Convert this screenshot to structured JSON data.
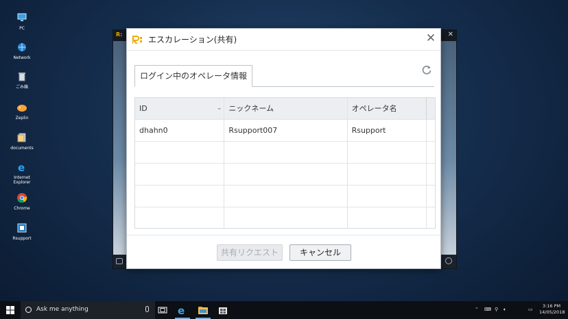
{
  "desktop": {
    "icons": [
      {
        "label": "PC",
        "icon": "monitor-icon"
      },
      {
        "label": "Network",
        "icon": "network-icon"
      },
      {
        "label": "ごみ箱",
        "icon": "recycle-bin-icon"
      },
      {
        "label": "Zeplin",
        "icon": "zeplin-icon"
      },
      {
        "label": "documents",
        "icon": "document-icon"
      },
      {
        "label": "Internet Explorer",
        "icon": "ie-icon"
      },
      {
        "label": "Chrome",
        "icon": "chrome-icon"
      },
      {
        "label": "Rsupport",
        "icon": "rsupport-icon"
      }
    ]
  },
  "dialog": {
    "title": "エスカレーション(共有)",
    "tab_label": "ログイン中のオペレータ情報",
    "columns": [
      "ID",
      "ニックネーム",
      "オペレータ名"
    ],
    "rows": [
      [
        "dhahn0",
        "Rsupport007",
        "Rsupport"
      ],
      [
        "",
        "",
        ""
      ],
      [
        "",
        "",
        ""
      ],
      [
        "",
        "",
        ""
      ],
      [
        "",
        "",
        ""
      ]
    ],
    "share_request_label": "共有リクエスト",
    "cancel_label": "キャンセル",
    "accent_color": "#f2a900"
  },
  "taskbar": {
    "search_placeholder": "Ask me anything",
    "time": "3:16 PM",
    "date": "14/05/2018"
  }
}
